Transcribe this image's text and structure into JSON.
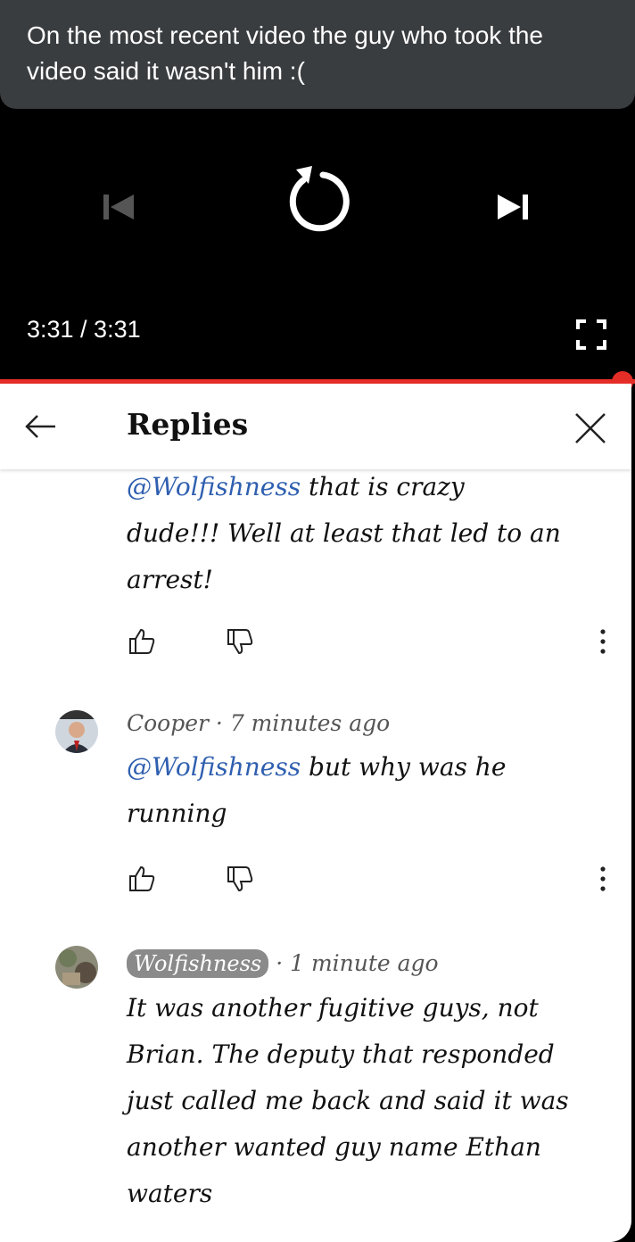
{
  "tweet": {
    "caption": "On the most recent video the guy who took the video said it wasn't him :("
  },
  "player": {
    "time": "3:31 / 3:31",
    "progress": 1.0,
    "accent": "#e52d27"
  },
  "replies_panel": {
    "title": "Replies",
    "back_icon": "arrow-left-icon",
    "close_icon": "close-icon"
  },
  "comments": [
    {
      "mention": "@Wolfishness",
      "text_line1_rest": " that is crazy",
      "text_rest": "dude!!! Well at least that led to an arrest!"
    },
    {
      "author": "Cooper",
      "age": " · 7 minutes ago",
      "mention": "@Wolfishness",
      "text_line1_rest": " but why was he",
      "text_rest": "running"
    },
    {
      "author": "Wolfishness",
      "age": " · 1 minute ago",
      "text": "It was another fugitive guys, not Brian. The deputy that responded just called me back and said it was another wanted guy name Ethan waters"
    }
  ]
}
